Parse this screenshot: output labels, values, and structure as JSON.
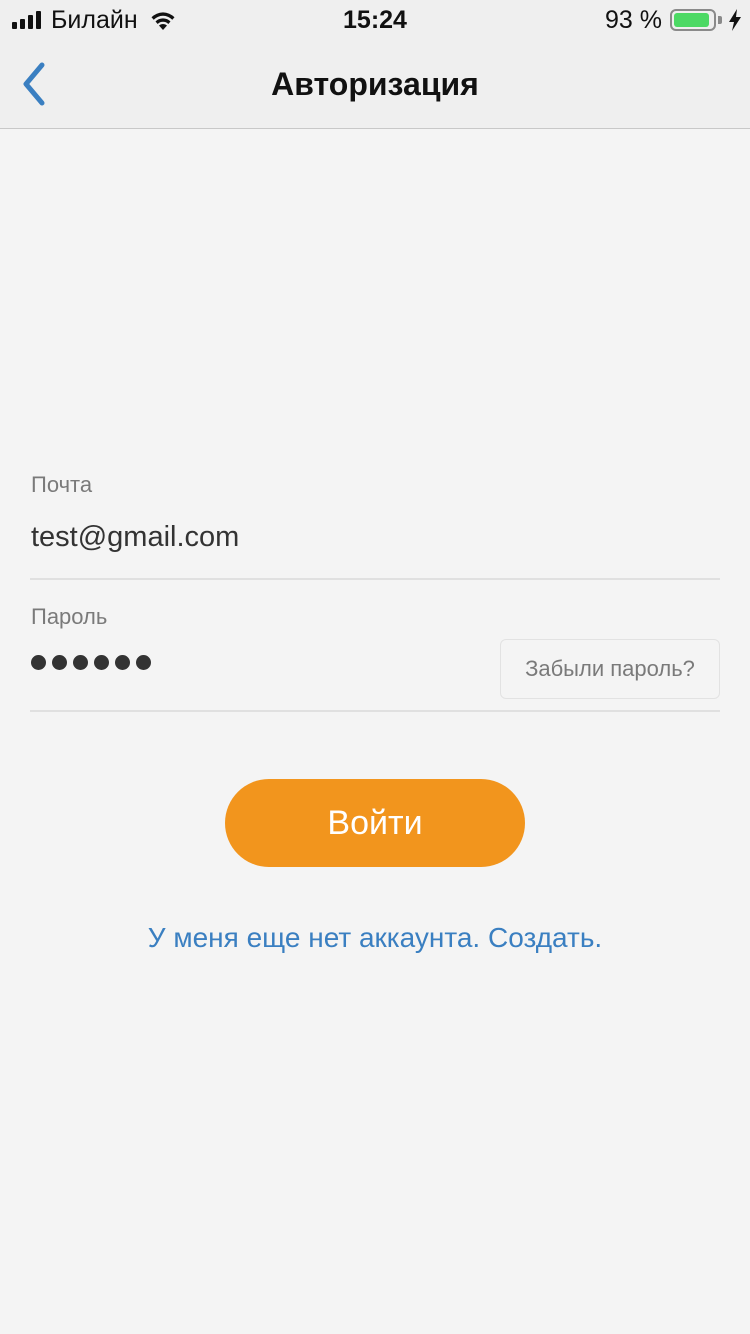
{
  "status_bar": {
    "carrier": "Билайн",
    "time": "15:24",
    "battery_percent": "93 %",
    "battery_level": 0.93,
    "battery_color": "#4cd964",
    "icons": [
      "signal-icon",
      "wifi-icon",
      "battery-icon",
      "charging-bolt-icon"
    ]
  },
  "nav": {
    "title": "Авторизация",
    "back_icon": "chevron-left-icon",
    "accent": "#3a7fc1"
  },
  "form": {
    "email": {
      "label": "Почта",
      "value": "test@gmail.com"
    },
    "password": {
      "label": "Пароль",
      "masked_length": 6
    },
    "forgot_label": "Забыли пароль?",
    "login_label": "Войти",
    "login_color": "#f2951d",
    "register_text": "У меня еще нет аккаунта. Создать."
  }
}
